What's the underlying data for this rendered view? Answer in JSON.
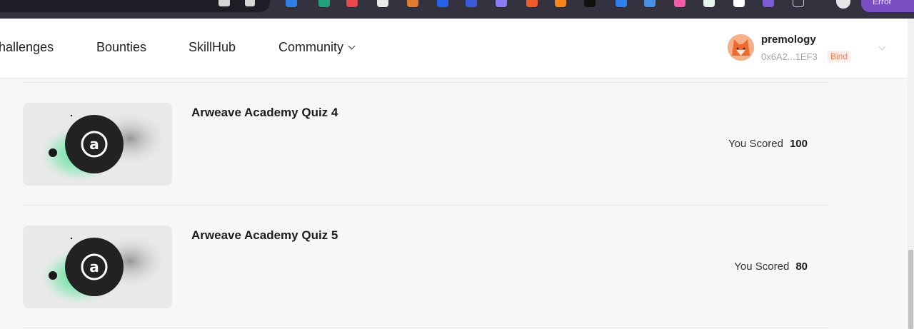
{
  "header": {
    "nav": [
      {
        "label": "hallenges"
      },
      {
        "label": "Bounties"
      },
      {
        "label": "SkillHub"
      },
      {
        "label": "Community"
      }
    ],
    "account": {
      "username": "premology",
      "address": "0x6A2...1EF3",
      "bind_label": "Bind"
    }
  },
  "browser": {
    "profile_label": "Error"
  },
  "quizzes": [
    {
      "title": "Arweave Academy Quiz 4",
      "score_label": "You Scored",
      "score": "100",
      "logo_letter": "a"
    },
    {
      "title": "Arweave Academy Quiz 5",
      "score_label": "You Scored",
      "score": "80",
      "logo_letter": "a"
    }
  ],
  "colors": {
    "brand_accent": "#f07b4e",
    "thumb_green": "#3ddc84",
    "page_bg": "#f7f7f7"
  }
}
